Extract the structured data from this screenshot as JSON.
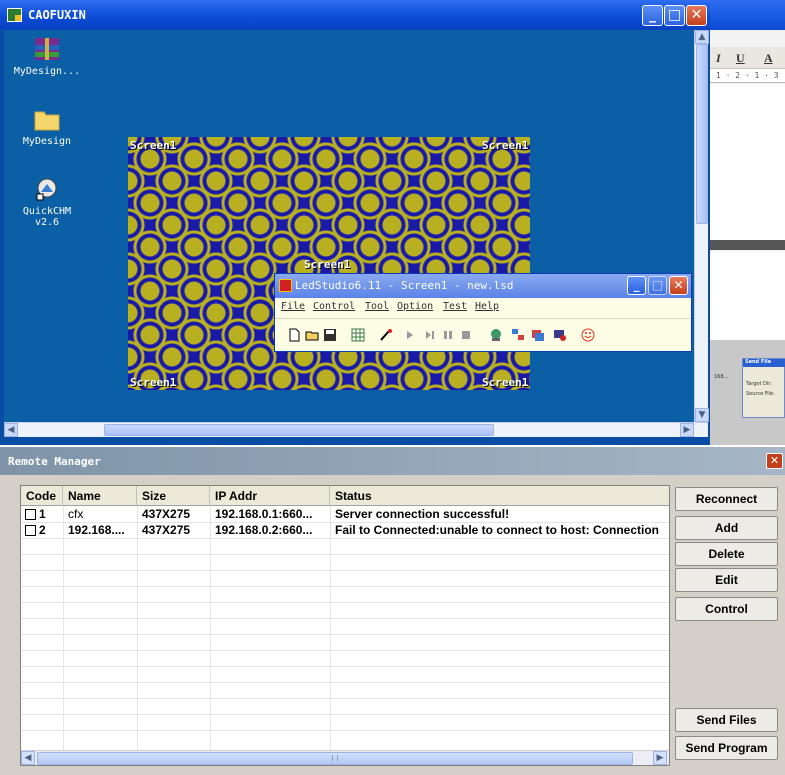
{
  "caofuxin_window": {
    "title": "CAOFUXIN"
  },
  "desktop_icons": [
    {
      "label": "MyDesign...",
      "icon": "winrar-archive-icon"
    },
    {
      "label": "MyDesign",
      "icon": "folder-icon"
    },
    {
      "label": "QuickCHM\nv2.6",
      "line1": "QuickCHM",
      "line2": "v2.6",
      "icon": "quickchm-icon"
    }
  ],
  "screen_preview": {
    "labels": [
      "Screen1",
      "Screen1",
      "Screen1",
      "Screen1",
      "Screen1"
    ]
  },
  "ledstudio": {
    "title": "LedStudio6.11 - Screen1 - new.lsd",
    "menu": [
      "File",
      "Control",
      "Tool",
      "Option",
      "Test",
      "Help"
    ]
  },
  "right_panel": {
    "ruler": "1 · 2 · 1 · 3 ·",
    "format_labels": [
      "I",
      "U",
      "A"
    ],
    "send_file_title": "Send File",
    "target_dir": "Target Dir:",
    "source_file": "Source File:",
    "list_item": "168..."
  },
  "remote_manager": {
    "title": "Remote Manager",
    "columns": [
      "Code",
      "Name",
      "Size",
      "IP Addr",
      "Status"
    ],
    "rows": [
      {
        "code": "1",
        "name": "cfx",
        "size": "437X275",
        "ip": "192.168.0.1:660...",
        "status": "Server connection successful!"
      },
      {
        "code": "2",
        "name": "192.168....",
        "size": "437X275",
        "ip": "192.168.0.2:660...",
        "status": "Fail to Connected:unable to connect to host: Connection"
      }
    ],
    "buttons": [
      "Reconnect",
      "Add",
      "Delete",
      "Edit",
      "Control",
      "Send Files",
      "Send Program"
    ]
  }
}
